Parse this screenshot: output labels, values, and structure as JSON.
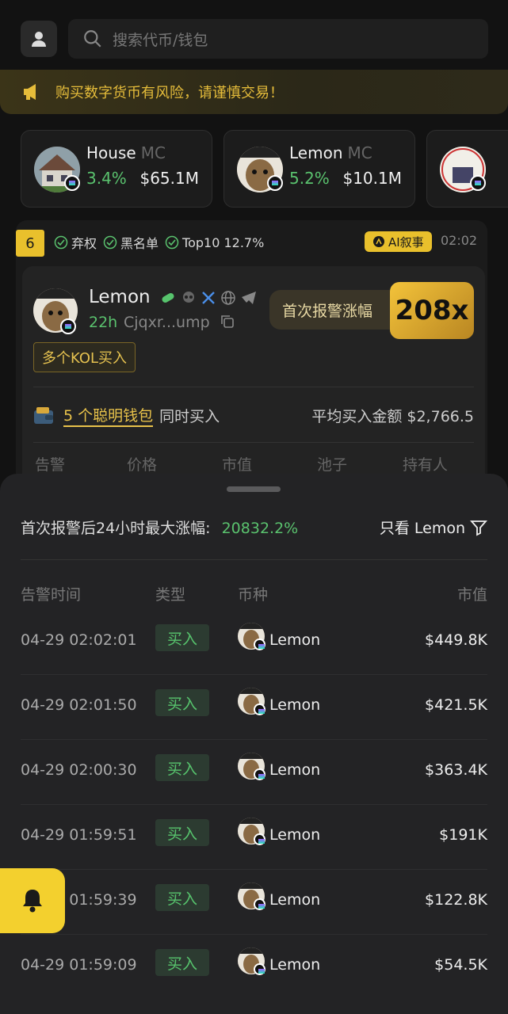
{
  "search": {
    "placeholder": "搜索代币/钱包"
  },
  "warning": {
    "text": "购买数字货币有风险，请谨慎交易！"
  },
  "trending": [
    {
      "name": "House",
      "mc_label": "MC",
      "pct": "3.4%",
      "value": "$65.1M"
    },
    {
      "name": "Lemon",
      "mc_label": "MC",
      "pct": "5.2%",
      "value": "$10.1M"
    },
    {
      "name": "",
      "mc_label": "",
      "pct": "",
      "value": ""
    }
  ],
  "card": {
    "rank": "6",
    "checks": [
      "弃权",
      "黑名单",
      "Top10 12.7%"
    ],
    "ai_label": "AI叙事",
    "time": "02:02",
    "token_name": "Lemon",
    "age": "22h",
    "address": "Cjqxr...ump",
    "alert_label": "首次报警涨幅",
    "alert_value": "208x",
    "kol_tag": "多个KOL买入",
    "smart_count": "5 个聪明钱包",
    "smart_suffix": "同时买入",
    "avg_buy": "平均买入金额 $2,766.5",
    "columns": [
      "告警",
      "价格",
      "市值",
      "池子",
      "持有人"
    ]
  },
  "sheet": {
    "title": "首次报警后24小时最大涨幅:",
    "max_gain": "20832.2%",
    "filter_label": "只看 Lemon",
    "headers": {
      "time": "告警时间",
      "type": "类型",
      "coin": "币种",
      "mc": "市值"
    },
    "rows": [
      {
        "time": "04-29 02:02:01",
        "type": "买入",
        "coin": "Lemon",
        "mc": "$449.8K"
      },
      {
        "time": "04-29 02:01:50",
        "type": "买入",
        "coin": "Lemon",
        "mc": "$421.5K"
      },
      {
        "time": "04-29 02:00:30",
        "type": "买入",
        "coin": "Lemon",
        "mc": "$363.4K"
      },
      {
        "time": "04-29 01:59:51",
        "type": "买入",
        "coin": "Lemon",
        "mc": "$191K"
      },
      {
        "time": "04-29 01:59:39",
        "type": "买入",
        "coin": "Lemon",
        "mc": "$122.8K"
      },
      {
        "time": "04-29 01:59:09",
        "type": "买入",
        "coin": "Lemon",
        "mc": "$54.5K"
      }
    ]
  },
  "colors": {
    "accent": "#e9c02c",
    "positive": "#5ac26e",
    "background": "#121212"
  }
}
